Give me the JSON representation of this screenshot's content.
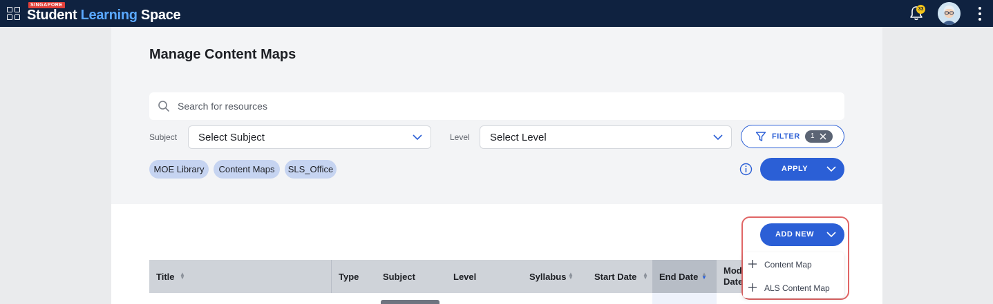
{
  "topbar": {
    "logo_tag": "SINGAPORE",
    "logo_part1": "Student ",
    "logo_part2": "Learning",
    "logo_part3": " Space",
    "notification_count": "33",
    "brand_color": "#0f2240",
    "icons": [
      "apps-grid-icon",
      "bell-icon",
      "avatar",
      "kebab-menu-icon"
    ]
  },
  "page": {
    "title": "Manage Content Maps"
  },
  "search": {
    "placeholder": "Search for resources",
    "value": ""
  },
  "filters": {
    "subject_label": "Subject",
    "subject_value": "Select Subject",
    "level_label": "Level",
    "level_value": "Select Level",
    "filter_label": "FILTER",
    "filter_count": "1"
  },
  "chips": [
    "MOE Library",
    "Content Maps",
    "SLS_Office"
  ],
  "apply_label": "APPLY",
  "add_new": {
    "label": "ADD NEW",
    "menu": [
      "Content Map",
      "ALS Content Map"
    ]
  },
  "table": {
    "columns": [
      "Title",
      "Type",
      "Subject",
      "Level",
      "Syllabus",
      "Start Date",
      "End Date",
      "Modified Date"
    ],
    "sorted_column": "End Date"
  },
  "colors": {
    "accent": "#2b5fd6",
    "chip_bg": "#c6d4f1",
    "highlight": "#e06565"
  }
}
